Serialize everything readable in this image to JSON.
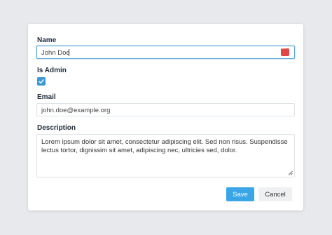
{
  "form": {
    "name": {
      "label": "Name",
      "value": "John Doe"
    },
    "is_admin": {
      "label": "Is Admin",
      "checked": true
    },
    "email": {
      "label": "Email",
      "value": "john.doe@example.org"
    },
    "description": {
      "label": "Description",
      "value": "Lorem ipsum dolor sit amet, consectetur adipiscing elit. Sed non risus. Suspendisse lectus tortor, dignissim sit amet, adipiscing nec, ultricies sed, dolor."
    },
    "buttons": {
      "save": "Save",
      "cancel": "Cancel"
    }
  },
  "colors": {
    "accent": "#3aa6e8",
    "checkbox": "#3a9ad9",
    "password_manager_icon": "#e04848",
    "background": "#e8e9ec"
  },
  "icons": {
    "name_field": "password-manager-icon",
    "checkbox": "checkmark-icon",
    "textarea": "resize-handle-icon"
  }
}
